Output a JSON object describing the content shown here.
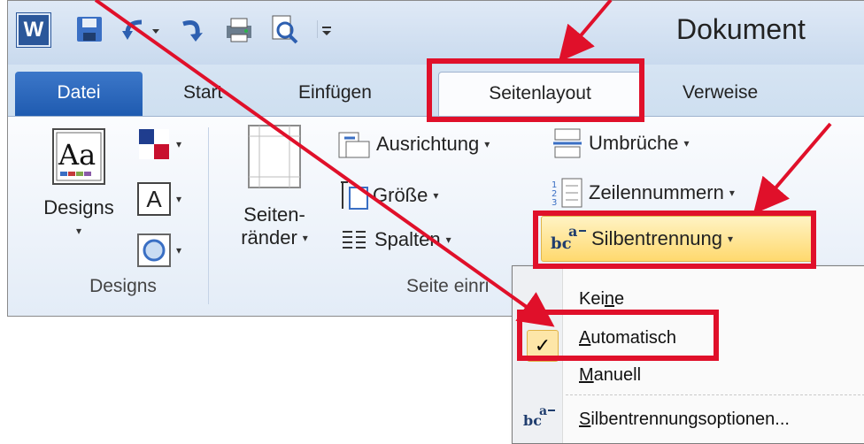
{
  "title_bar": {
    "app_logo": "W",
    "document_title": "Dokument"
  },
  "tabs": [
    {
      "label": "Datei"
    },
    {
      "label": "Start"
    },
    {
      "label": "Einfügen"
    },
    {
      "label": "Seitenlayout"
    },
    {
      "label": "Verweise"
    }
  ],
  "ribbon": {
    "designs_group": {
      "designs_button": "Designs",
      "group_label": "Designs",
      "font_glyph": "A"
    },
    "page_setup_group": {
      "margins_line1": "Seiten-",
      "margins_line2": "ränder",
      "orientation": "Ausrichtung",
      "size": "Größe",
      "columns": "Spalten",
      "breaks": "Umbrüche",
      "line_numbers": "Zeilennummern",
      "hyphenation": "Silbentrennung",
      "group_label": "Seite einri"
    }
  },
  "hyphenation_menu": {
    "items": [
      {
        "pre": "Kei",
        "key": "n",
        "post": "e"
      },
      {
        "pre": "",
        "key": "A",
        "post": "utomatisch",
        "checked": true
      },
      {
        "pre": "",
        "key": "M",
        "post": "anuell"
      },
      {
        "pre": "",
        "key": "S",
        "post": "ilbentrennungsoptionen..."
      }
    ],
    "check_glyph": "✓"
  },
  "colors": {
    "highlight_red": "#e0102a",
    "file_tab": "#2b64b8"
  }
}
